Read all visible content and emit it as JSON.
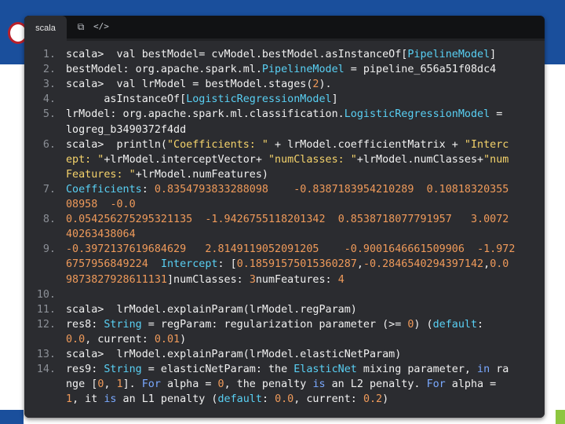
{
  "tab": {
    "label": "scala"
  },
  "icons": {
    "copy": "copy-icon",
    "code": "code-icon"
  },
  "colors": {
    "header": "#1a4f9c",
    "editor_bg": "#2b2c30",
    "type": "#59d0f4",
    "string": "#f5d36b",
    "number": "#ef9a5a",
    "keyword": "#7aa9ff"
  },
  "code": {
    "lines": [
      {
        "num": "1.",
        "segments": [
          {
            "text": "scala>  val bestModel= cvModel.bestModel.asInstanceOf["
          },
          {
            "text": "PipelineModel",
            "cls": "t"
          },
          {
            "text": "]"
          }
        ]
      },
      {
        "num": "2.",
        "segments": [
          {
            "text": "bestModel: org.apache.spark.ml."
          },
          {
            "text": "PipelineModel",
            "cls": "t"
          },
          {
            "text": " = pipeline_656a51f08dc4"
          }
        ]
      },
      {
        "num": "3.",
        "segments": [
          {
            "text": "scala>  val lrModel = bestModel.stages("
          },
          {
            "text": "2",
            "cls": "n"
          },
          {
            "text": ")."
          }
        ]
      },
      {
        "num": "4.",
        "segments": [
          {
            "text": "      asInstanceOf["
          },
          {
            "text": "LogisticRegressionModel",
            "cls": "t"
          },
          {
            "text": "]"
          }
        ]
      },
      {
        "num": "5.",
        "segments": [
          {
            "text": "lrModel: org.apache.spark.ml.classification."
          },
          {
            "text": "LogisticRegressionModel",
            "cls": "t"
          },
          {
            "text": " ="
          }
        ]
      },
      {
        "num": "",
        "segments": [
          {
            "text": "logreg_b3490372f4dd"
          }
        ]
      },
      {
        "num": "6.",
        "segments": [
          {
            "text": "scala>  println("
          },
          {
            "text": "\"Coefficients: \"",
            "cls": "s"
          },
          {
            "text": " + lrModel.coefficientMatrix + "
          },
          {
            "text": "\"Interc",
            "cls": "s"
          }
        ]
      },
      {
        "num": "",
        "segments": [
          {
            "text": "ept: \"",
            "cls": "s"
          },
          {
            "text": "+lrModel.interceptVector+ "
          },
          {
            "text": "\"numClasses: \"",
            "cls": "s"
          },
          {
            "text": "+lrModel.numClasses+"
          },
          {
            "text": "\"num",
            "cls": "s"
          }
        ]
      },
      {
        "num": "",
        "segments": [
          {
            "text": "Features: \"",
            "cls": "s"
          },
          {
            "text": "+lrModel.numFeatures)"
          }
        ]
      },
      {
        "num": "7.",
        "segments": [
          {
            "text": "Coefficients",
            "cls": "t"
          },
          {
            "text": ": "
          },
          {
            "text": "0.8354793833288098",
            "cls": "n"
          },
          {
            "text": "    "
          },
          {
            "text": "-0.8387183954210289",
            "cls": "n"
          },
          {
            "text": "  "
          },
          {
            "text": "0.10818320355",
            "cls": "n"
          }
        ]
      },
      {
        "num": "",
        "segments": [
          {
            "text": "08958",
            "cls": "n"
          },
          {
            "text": "  "
          },
          {
            "text": "-0.0",
            "cls": "n"
          }
        ]
      },
      {
        "num": "8.",
        "segments": [
          {
            "text": "0.054256275295321135",
            "cls": "n"
          },
          {
            "text": "  "
          },
          {
            "text": "-1.9426755118201342",
            "cls": "n"
          },
          {
            "text": "  "
          },
          {
            "text": "0.8538718077791957",
            "cls": "n"
          },
          {
            "text": "   "
          },
          {
            "text": "3.0072",
            "cls": "n"
          }
        ]
      },
      {
        "num": "",
        "segments": [
          {
            "text": "40263438064",
            "cls": "n"
          }
        ]
      },
      {
        "num": "9.",
        "segments": [
          {
            "text": "-0.3972137619684629",
            "cls": "n"
          },
          {
            "text": "   "
          },
          {
            "text": "2.8149119052091205",
            "cls": "n"
          },
          {
            "text": "    "
          },
          {
            "text": "-0.9001646661509906",
            "cls": "n"
          },
          {
            "text": "  "
          },
          {
            "text": "-1.972",
            "cls": "n"
          }
        ]
      },
      {
        "num": "",
        "segments": [
          {
            "text": "6757956849224",
            "cls": "n"
          },
          {
            "text": "  "
          },
          {
            "text": "Intercept",
            "cls": "t"
          },
          {
            "text": ": ["
          },
          {
            "text": "0.18591575015360287",
            "cls": "n"
          },
          {
            "text": ","
          },
          {
            "text": "-0.2846540294397142",
            "cls": "n"
          },
          {
            "text": ","
          },
          {
            "text": "0.0",
            "cls": "n"
          }
        ]
      },
      {
        "num": "",
        "segments": [
          {
            "text": "9873827928611131",
            "cls": "n"
          },
          {
            "text": "]numClasses: "
          },
          {
            "text": "3",
            "cls": "n"
          },
          {
            "text": "numFeatures: "
          },
          {
            "text": "4",
            "cls": "n"
          }
        ]
      },
      {
        "num": "10.",
        "segments": [
          {
            "text": ""
          }
        ]
      },
      {
        "num": "11.",
        "segments": [
          {
            "text": "scala>  lrModel.explainParam(lrModel.regParam)"
          }
        ]
      },
      {
        "num": "12.",
        "segments": [
          {
            "text": "res8: "
          },
          {
            "text": "String",
            "cls": "t"
          },
          {
            "text": " = regParam: regularization parameter (>= "
          },
          {
            "text": "0",
            "cls": "n"
          },
          {
            "text": ") ("
          },
          {
            "text": "default",
            "cls": "t"
          },
          {
            "text": ":"
          }
        ]
      },
      {
        "num": "",
        "segments": [
          {
            "text": "0.0",
            "cls": "n"
          },
          {
            "text": ", current: "
          },
          {
            "text": "0.01",
            "cls": "n"
          },
          {
            "text": ")"
          }
        ]
      },
      {
        "num": "13.",
        "segments": [
          {
            "text": "scala>  lrModel.explainParam(lrModel.elasticNetParam)"
          }
        ]
      },
      {
        "num": "14.",
        "segments": [
          {
            "text": "res9: "
          },
          {
            "text": "String",
            "cls": "t"
          },
          {
            "text": " = elasticNetParam: the "
          },
          {
            "text": "ElasticNet",
            "cls": "t"
          },
          {
            "text": " mixing parameter, "
          },
          {
            "text": "in",
            "cls": "k"
          },
          {
            "text": " ra"
          }
        ]
      },
      {
        "num": "",
        "segments": [
          {
            "text": "nge ["
          },
          {
            "text": "0",
            "cls": "n"
          },
          {
            "text": ", "
          },
          {
            "text": "1",
            "cls": "n"
          },
          {
            "text": "]. "
          },
          {
            "text": "For",
            "cls": "k"
          },
          {
            "text": " alpha = "
          },
          {
            "text": "0",
            "cls": "n"
          },
          {
            "text": ", the penalty "
          },
          {
            "text": "is",
            "cls": "k"
          },
          {
            "text": " an L2 penalty. "
          },
          {
            "text": "For",
            "cls": "k"
          },
          {
            "text": " alpha ="
          }
        ]
      },
      {
        "num": "",
        "segments": [
          {
            "text": "1",
            "cls": "n"
          },
          {
            "text": ", it "
          },
          {
            "text": "is",
            "cls": "k"
          },
          {
            "text": " an L1 penalty ("
          },
          {
            "text": "default",
            "cls": "t"
          },
          {
            "text": ": "
          },
          {
            "text": "0.0",
            "cls": "n"
          },
          {
            "text": ", current: "
          },
          {
            "text": "0.2",
            "cls": "n"
          },
          {
            "text": ")"
          }
        ]
      }
    ]
  }
}
